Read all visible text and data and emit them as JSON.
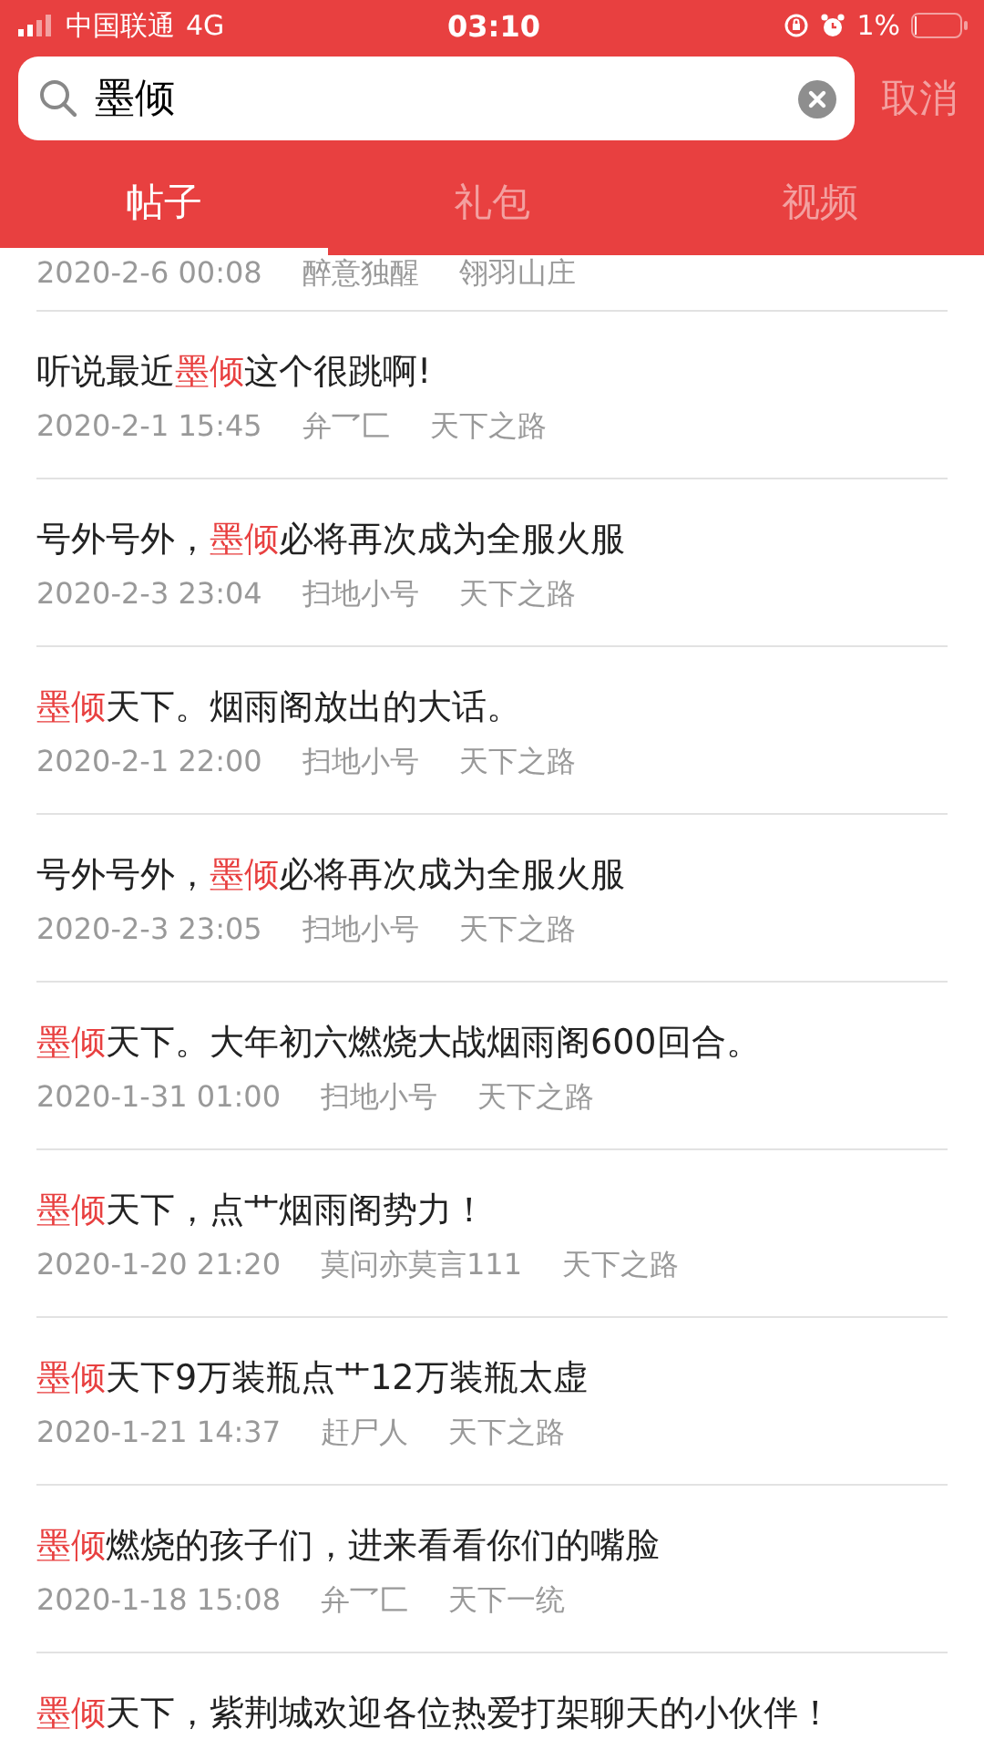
{
  "status_bar": {
    "carrier": "中国联通",
    "network": "4G",
    "time": "03:10",
    "battery": "1%"
  },
  "search": {
    "value": "墨倾",
    "cancel": "取消"
  },
  "tabs": [
    {
      "label": "帖子",
      "selected": true
    },
    {
      "label": "礼包",
      "selected": false
    },
    {
      "label": "视频",
      "selected": false
    }
  ],
  "posts": [
    {
      "date": "2020-2-6 00:08",
      "author": "醉意独醒",
      "server": "翎羽山庄"
    },
    {
      "title": {
        "before": "听说最近",
        "keyword": "墨倾",
        "after": "这个很跳啊!"
      },
      "date": "2020-2-1 15:45",
      "author": "弁乛匚",
      "server": "天下之路"
    },
    {
      "title": {
        "before": "号外号外，",
        "keyword": "墨倾",
        "after": "必将再次成为全服火服"
      },
      "date": "2020-2-3 23:04",
      "author": "扫地小号",
      "server": "天下之路"
    },
    {
      "title": {
        "keyword": "墨倾",
        "after": "天下。烟雨阁放出的大话。"
      },
      "date": "2020-2-1 22:00",
      "author": "扫地小号",
      "server": "天下之路"
    },
    {
      "title": {
        "before": "号外号外，",
        "keyword": "墨倾",
        "after": "必将再次成为全服火服"
      },
      "date": "2020-2-3 23:05",
      "author": "扫地小号",
      "server": "天下之路"
    },
    {
      "title": {
        "keyword": "墨倾",
        "after": "天下。大年初六燃烧大战烟雨阁600回合。"
      },
      "date": "2020-1-31 01:00",
      "author": "扫地小号",
      "server": "天下之路"
    },
    {
      "title": {
        "keyword": "墨倾",
        "after": "天下，点艹烟雨阁势力！"
      },
      "date": "2020-1-20 21:20",
      "author": "莫问亦莫言111",
      "server": "天下之路"
    },
    {
      "title": {
        "keyword": "墨倾",
        "after": "天下9万装瓶点艹12万装瓶太虚"
      },
      "date": "2020-1-21 14:37",
      "author": "赶尸人",
      "server": "天下之路"
    },
    {
      "title": {
        "keyword": "墨倾",
        "after": "燃烧的孩子们，进来看看你们的嘴脸"
      },
      "date": "2020-1-18 15:08",
      "author": "弁乛匚",
      "server": "天下一统"
    },
    {
      "title": {
        "keyword": "墨倾",
        "after": "天下，紫荆城欢迎各位热爱打架聊天的小伙伴！"
      }
    }
  ]
}
